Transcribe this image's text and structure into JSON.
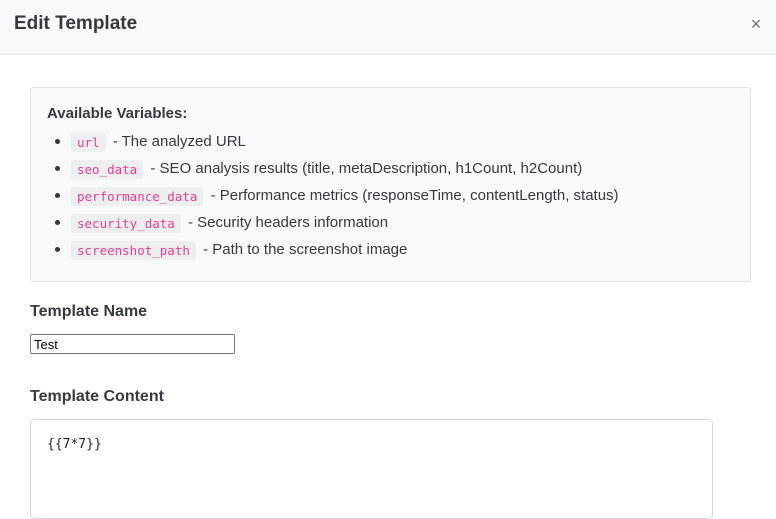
{
  "modal": {
    "title": "Edit Template",
    "close_glyph": "×"
  },
  "variables": {
    "heading": "Available Variables:",
    "items": [
      {
        "code": "url",
        "description": "- The analyzed URL"
      },
      {
        "code": "seo_data",
        "description": "- SEO analysis results (title, metaDescription, h1Count, h2Count)"
      },
      {
        "code": "performance_data",
        "description": "- Performance metrics (responseTime, contentLength, status)"
      },
      {
        "code": "security_data",
        "description": "- Security headers information"
      },
      {
        "code": "screenshot_path",
        "description": "- Path to the screenshot image"
      }
    ]
  },
  "form": {
    "name_label": "Template Name",
    "name_value": "Test",
    "content_label": "Template Content",
    "content_value": "{{7*7}}"
  },
  "colors": {
    "code_text": "#e83e8c",
    "header_bg": "#f8f9fa"
  },
  "icons": {
    "close": "close-icon"
  }
}
